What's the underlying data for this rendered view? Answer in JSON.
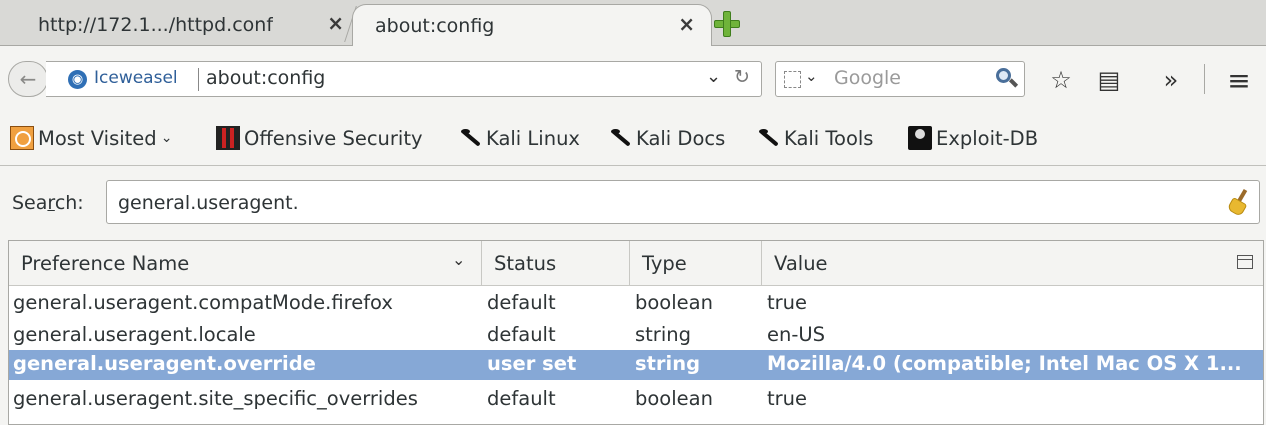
{
  "tabs": [
    {
      "title": "http://172.1.../httpd.conf",
      "close": "×"
    },
    {
      "title": "about:config",
      "close": "×"
    }
  ],
  "navbar": {
    "back_glyph": "←",
    "identity_label": "Iceweasel",
    "url": "about:config",
    "url_dropdown_glyph": "⌄",
    "reload_glyph": "↻",
    "search_placeholder": "Google",
    "engine_dropdown_glyph": "⌄",
    "bookmark_star_glyph": "☆",
    "reading_list_glyph": "▤",
    "overflow_glyph": "»",
    "menu_glyph": "≡"
  },
  "bookmarks": [
    {
      "label": "Most Visited",
      "icon": "most-visited-icon",
      "chevron": "⌄"
    },
    {
      "label": "Offensive Security",
      "icon": "offensive-security-icon"
    },
    {
      "label": "Kali Linux",
      "icon": "kali-dragon-icon"
    },
    {
      "label": "Kali Docs",
      "icon": "kali-dragon-icon"
    },
    {
      "label": "Kali Tools",
      "icon": "kali-dragon-icon"
    },
    {
      "label": "Exploit-DB",
      "icon": "exploit-db-icon"
    }
  ],
  "config": {
    "search_label_pre": "Sea",
    "search_label_access": "r",
    "search_label_post": "ch:",
    "search_value": "general.useragent.",
    "columns": {
      "name": "Preference Name",
      "sort_glyph": "⌄",
      "status": "Status",
      "type": "Type",
      "value": "Value"
    },
    "rows": [
      {
        "name": "general.useragent.compatMode.firefox",
        "status": "default",
        "type": "boolean",
        "value": "true",
        "selected": false
      },
      {
        "name": "general.useragent.locale",
        "status": "default",
        "type": "string",
        "value": "en-US",
        "selected": false
      },
      {
        "name": "general.useragent.override",
        "status": "user set",
        "type": "string",
        "value": "Mozilla/4.0 (compatible; Intel Mac OS X 1...",
        "selected": true
      },
      {
        "name": "general.useragent.site_specific_overrides",
        "status": "default",
        "type": "boolean",
        "value": "true",
        "selected": false
      }
    ]
  },
  "colors": {
    "selection": "#86a8d6",
    "chrome": "#f4f4f2",
    "newtab_green": "#6fb33a"
  }
}
